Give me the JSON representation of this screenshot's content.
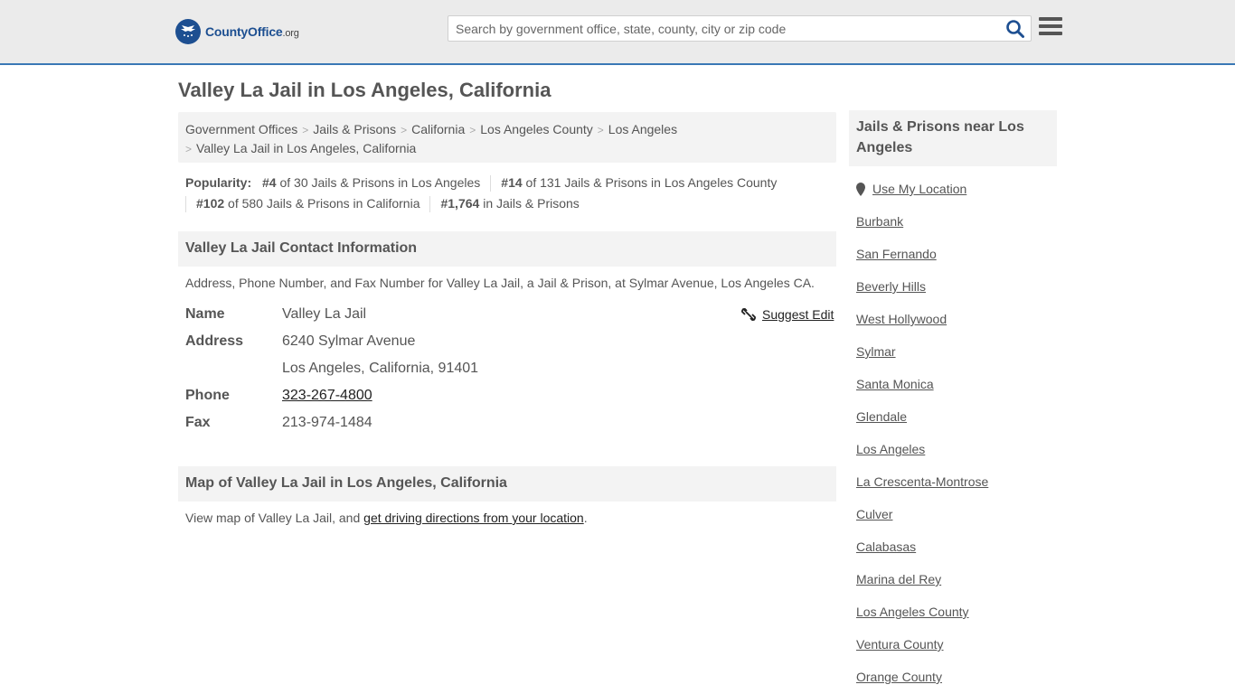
{
  "header": {
    "logo_name": "CountyOffice",
    "logo_tld": ".org",
    "search_placeholder": "Search by government office, state, county, city or zip code"
  },
  "page_title": "Valley La Jail in Los Angeles, California",
  "breadcrumb": [
    "Government Offices",
    "Jails & Prisons",
    "California",
    "Los Angeles County",
    "Los Angeles",
    "Valley La Jail in Los Angeles, California"
  ],
  "popularity": {
    "label": "Popularity:",
    "items": [
      {
        "rank": "#4",
        "text": "of 30 Jails & Prisons in Los Angeles"
      },
      {
        "rank": "#14",
        "text": "of 131 Jails & Prisons in Los Angeles County"
      },
      {
        "rank": "#102",
        "text": "of 580 Jails & Prisons in California"
      },
      {
        "rank": "#1,764",
        "text": "in Jails & Prisons"
      }
    ]
  },
  "contact": {
    "heading": "Valley La Jail Contact Information",
    "intro": "Address, Phone Number, and Fax Number for Valley La Jail, a Jail & Prison, at Sylmar Avenue, Los Angeles CA.",
    "suggest_edit": "Suggest Edit",
    "name_label": "Name",
    "name": "Valley La Jail",
    "address_label": "Address",
    "address_line1": "6240 Sylmar Avenue",
    "address_line2": "Los Angeles, California, 91401",
    "phone_label": "Phone",
    "phone": "323-267-4800",
    "fax_label": "Fax",
    "fax": "213-974-1484"
  },
  "map": {
    "heading": "Map of Valley La Jail in Los Angeles, California",
    "text_before": "View map of Valley La Jail, and ",
    "link": "get driving directions from your location",
    "text_after": "."
  },
  "sidebar": {
    "heading": "Jails & Prisons near Los Angeles",
    "use_location": "Use My Location",
    "links": [
      "Burbank",
      "San Fernando",
      "Beverly Hills",
      "West Hollywood",
      "Sylmar",
      "Santa Monica",
      "Glendale",
      "Los Angeles",
      "La Crescenta-Montrose",
      "Culver",
      "Calabasas",
      "Marina del Rey",
      "Los Angeles County",
      "Ventura County",
      "Orange County"
    ]
  },
  "colors": {
    "header_bg": "#ebebeb",
    "accent_border": "#3a78b5",
    "logo_blue": "#1d4f91",
    "search_icon": "#1d4f91",
    "panel_bg": "#f3f3f3",
    "text": "#555555"
  }
}
